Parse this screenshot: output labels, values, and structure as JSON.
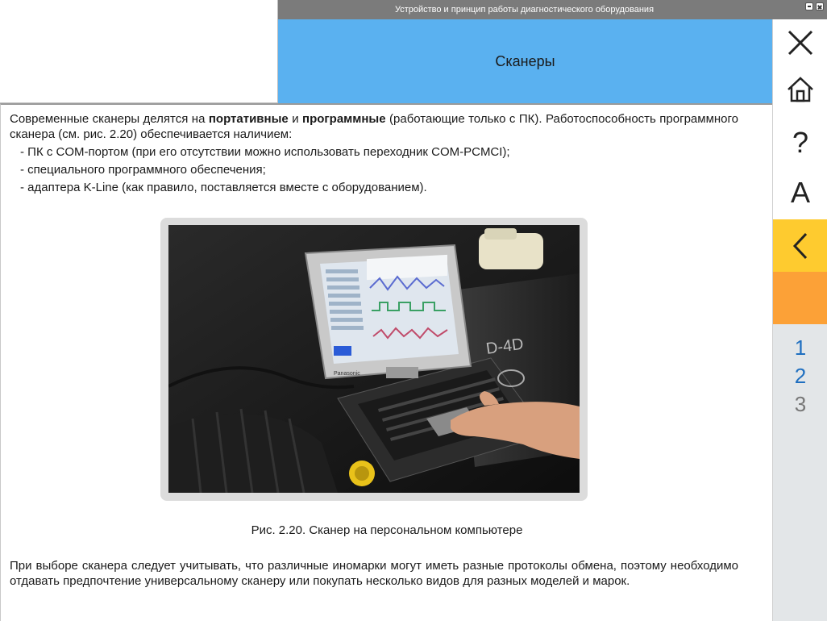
{
  "window": {
    "title": "Устройство и принцип работы диагностического оборудования"
  },
  "section": {
    "title": "Сканеры"
  },
  "sidebar": {
    "close_icon": "close-icon",
    "home_icon": "home-icon",
    "help_label": "?",
    "font_label": "A",
    "back_icon": "chevron-left-icon",
    "colors": {
      "back": "#fecb2f",
      "orange": "#fca137",
      "pager_bg": "#e3e6e8",
      "link": "#1f6fc0"
    },
    "pages": [
      "1",
      "2",
      "3"
    ],
    "current_page": "3"
  },
  "content": {
    "para1": {
      "t1": "Современные сканеры делятся на ",
      "b1": "портативные",
      "t2": " и ",
      "b2": "программные",
      "t3": " (работающие только с ПК). Работоспособность программного сканера (см. рис. 2.20) обеспечивается наличием:"
    },
    "list": [
      "- ПК с COM-портом (при его отсутствии можно использовать переходник COM-PCMCI);",
      "- специального программного обеспечения;",
      "- адаптера K-Line (как правило, поставляется вместе с оборудованием)."
    ],
    "figure": {
      "caption": "Рис. 2.20. Сканер на персональном компьютере",
      "laptop_brand": "Panasonic",
      "engine_label": "D-4D"
    },
    "para2": "При выборе сканера следует учитывать, что различные иномарки могут иметь разные протоколы обмена, поэтому необходимо отдавать предпочтение универсальному сканеру или покупать несколько видов для разных моделей и марок."
  },
  "colors": {
    "titlebar": "#7b7b7b",
    "header": "#5ab1f0"
  }
}
